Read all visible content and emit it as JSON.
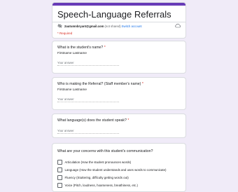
{
  "form": {
    "title": "Speech-Language Referrals",
    "account_email": "2autumnbryant@gmail.com",
    "not_shared": "(not shared)",
    "switch_account": "Switch account",
    "required_note": "* Required",
    "accent_color": "#673ab7"
  },
  "questions": [
    {
      "title": "What is the student's name?",
      "required": "*",
      "description": "Firstname Lastname",
      "placeholder": "Your answer"
    },
    {
      "title": "Who is making the Referral? (Staff member's name)",
      "required": "*",
      "description": "Firstname Lastname",
      "placeholder": "Your answer"
    },
    {
      "title": "What language(s) does the student speak?",
      "required": "*",
      "placeholder": "Your answer"
    },
    {
      "title": "What are your concerns with this student's communication?",
      "options": [
        "Articulation (How the student pronounces words)",
        "Language (How the student understands and uses words to communicate)",
        "Fluency (Stuttering, difficulty getting words out)",
        "Voice (Pitch, loudness, hoarseness, breathiness, etc.)"
      ]
    }
  ]
}
